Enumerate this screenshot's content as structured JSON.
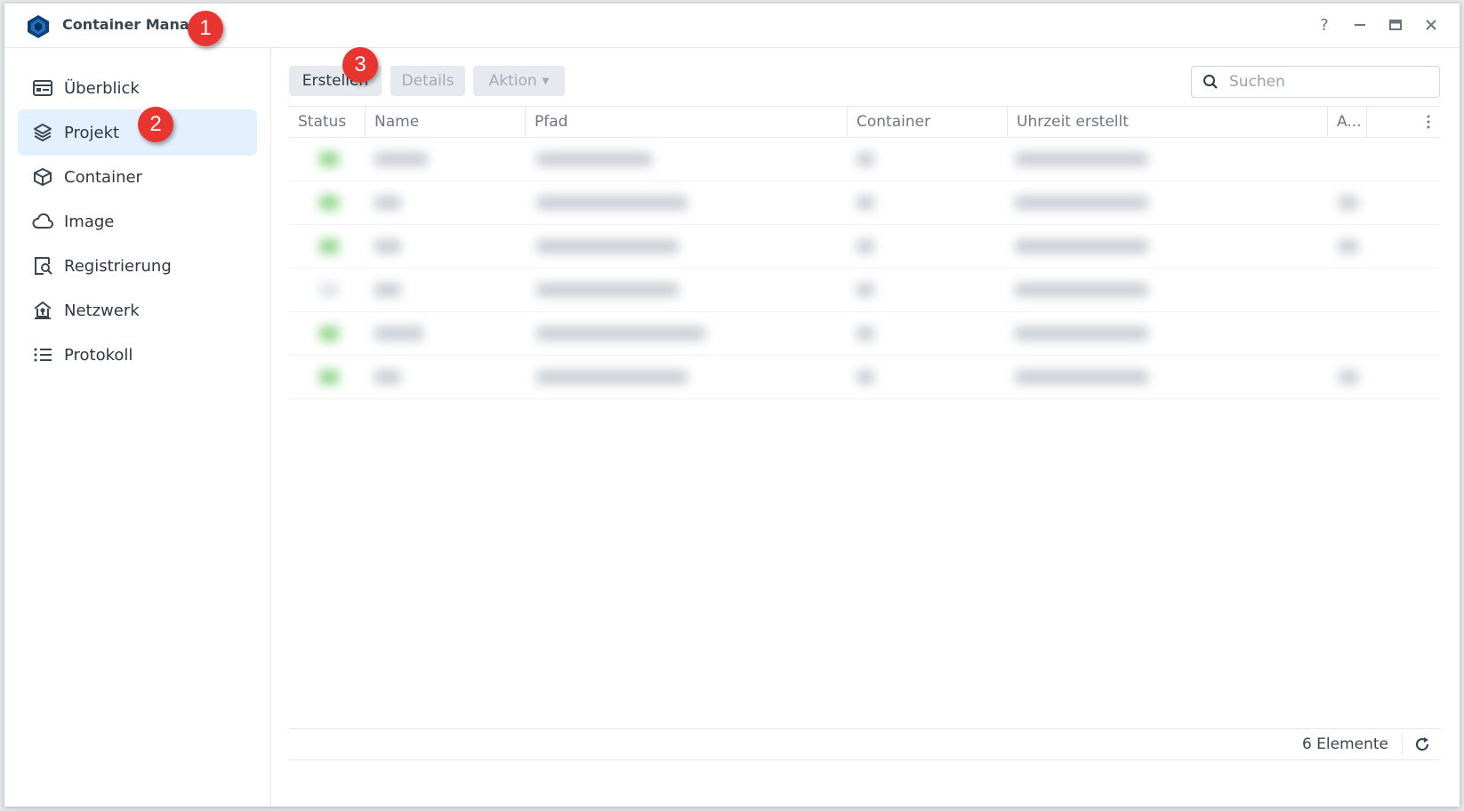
{
  "window": {
    "title": "Container Manager",
    "controls": [
      "help-icon",
      "minimize-icon",
      "maximize-icon",
      "close-icon"
    ]
  },
  "sidebar": {
    "items": [
      {
        "label": "Überblick",
        "icon": "overview-icon",
        "active": false
      },
      {
        "label": "Projekt",
        "icon": "project-layers-icon",
        "active": true
      },
      {
        "label": "Container",
        "icon": "container-cube-icon",
        "active": false
      },
      {
        "label": "Image",
        "icon": "cloud-icon",
        "active": false
      },
      {
        "label": "Registrierung",
        "icon": "registry-search-icon",
        "active": false
      },
      {
        "label": "Netzwerk",
        "icon": "network-house-icon",
        "active": false
      },
      {
        "label": "Protokoll",
        "icon": "log-list-icon",
        "active": false
      }
    ]
  },
  "toolbar": {
    "create_label": "Erstellen",
    "details_label": "Details",
    "action_label": "Aktion"
  },
  "search": {
    "placeholder": "Suchen",
    "value": ""
  },
  "table": {
    "columns": [
      "Status",
      "Name",
      "Pfad",
      "Container",
      "Uhrzeit erstellt",
      "A..."
    ],
    "row_count_visible": 6,
    "rows_blurred": true
  },
  "footer": {
    "count_label": "6 Elemente"
  },
  "annotations": [
    "1",
    "2",
    "3"
  ],
  "colors": {
    "accent_active_bg": "#e3f0fd",
    "badge_red": "#e8352f",
    "status_green": "#8fd68a",
    "logo_blue": "#1f6fbf"
  }
}
